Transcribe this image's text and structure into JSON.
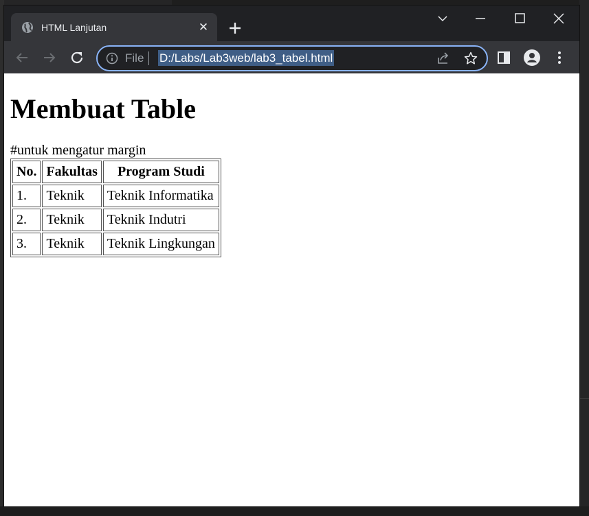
{
  "browser": {
    "tab": {
      "title": "HTML Lanjutan",
      "close": "✕"
    },
    "omnibox": {
      "scheme": "File",
      "url": "D:/Labs/Lab3web/lab3_tabel.html"
    }
  },
  "page": {
    "heading": "Membuat Table",
    "note": "#untuk mengatur margin",
    "table": {
      "headers": [
        "No.",
        "Fakultas",
        "Program Studi"
      ],
      "rows": [
        [
          "1.",
          "Teknik",
          "Teknik Informatika"
        ],
        [
          "2.",
          "Teknik",
          "Teknik Indutri"
        ],
        [
          "3.",
          "Teknik",
          "Teknik Lingkungan"
        ]
      ]
    }
  },
  "colors": {
    "chrome_dark": "#202124",
    "chrome_toolbar": "#35363a",
    "omnibox_focus": "#8ab4f8",
    "url_selection": "#3f5e86"
  }
}
